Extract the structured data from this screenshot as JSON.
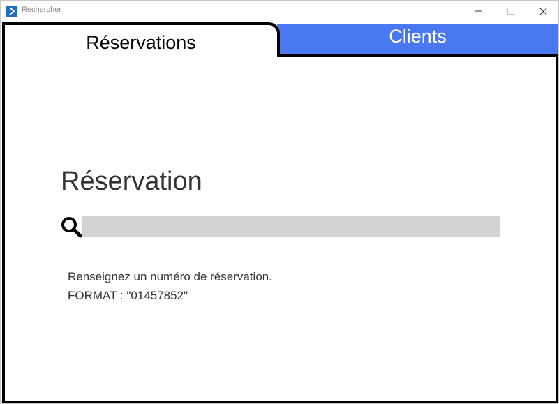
{
  "window": {
    "title": "Rechercher",
    "app_icon": "app-arrow-icon",
    "controls": [
      "minimize-icon",
      "maximize-icon",
      "close-icon"
    ]
  },
  "tabs": [
    {
      "label": "Réservations",
      "active": true
    },
    {
      "label": "Clients",
      "active": false
    }
  ],
  "colors": {
    "tab_inactive_bg": "#4a78f0",
    "input_bg": "#d3d3d3",
    "border": "#000000"
  },
  "main": {
    "section_title": "Réservation",
    "search": {
      "value": "",
      "placeholder": ""
    },
    "hint_line1": "Renseignez un numéro de réservation.",
    "hint_line2": "FORMAT : \"01457852\""
  }
}
